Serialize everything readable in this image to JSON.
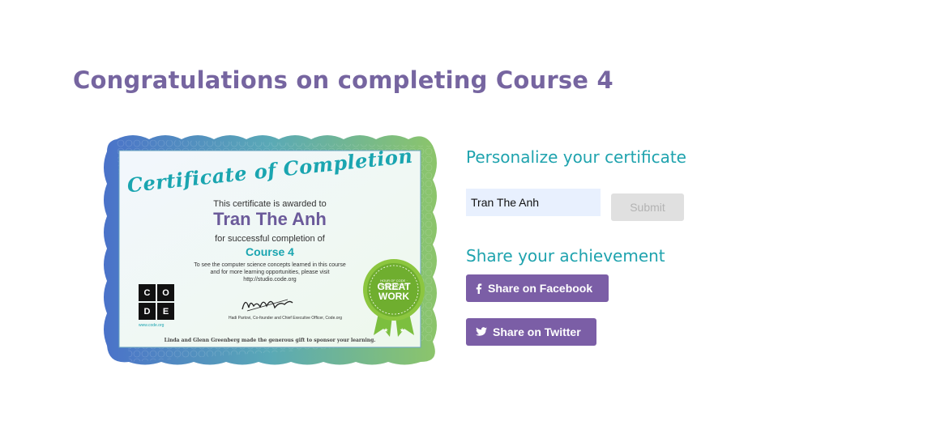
{
  "page": {
    "title": "Congratulations on completing Course 4"
  },
  "certificate": {
    "heading": "Certificate of Completion",
    "awarded_text": "This certificate is awarded to",
    "recipient_name": "Tran The Anh",
    "completion_text": "for successful completion of",
    "course_name": "Course 4",
    "info_line_1": "To see the computer science concepts learned in this course",
    "info_line_2": "and for more learning opportunities, please visit",
    "info_url": "http://studio.code.org",
    "logo_letters": [
      "C",
      "O",
      "D",
      "E"
    ],
    "logo_url": "www.code.org",
    "signature": "Hadi Partovi",
    "signature_caption": "Hadi Partovi, Co-founder and Chief Executive Officer, Code.org",
    "footer": "Linda and Glenn Greenberg made the generous gift to sponsor your learning.",
    "badge_top": "HOUR OF CODE · LEARN COMPUTER SCIENCE",
    "badge_label": "GREAT WORK"
  },
  "personalize": {
    "title": "Personalize your certificate",
    "name_value": "Tran The Anh",
    "submit_label": "Submit"
  },
  "share": {
    "title": "Share your achievement",
    "facebook_label": "Share on Facebook",
    "twitter_label": "Share on Twitter"
  },
  "colors": {
    "title_purple": "#7665a0",
    "section_teal": "#1fa3ae",
    "button_purple": "#7b5ea6",
    "input_bg": "#e8f0fe",
    "submit_disabled_bg": "#e0e0e0"
  },
  "icons": {
    "facebook": "facebook-icon",
    "twitter": "twitter-icon",
    "badge": "ribbon-badge-icon"
  }
}
